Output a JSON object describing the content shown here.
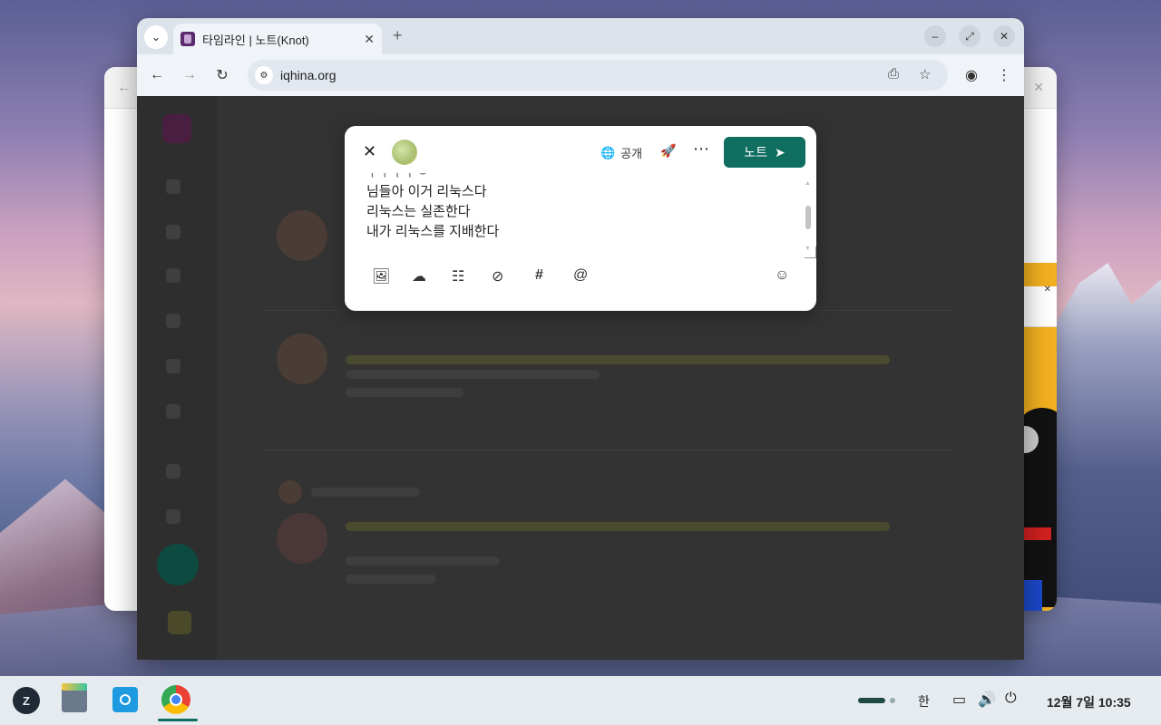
{
  "browser": {
    "tab_title": "타임라인 | 노트(Knot)",
    "url": "iqhina.org"
  },
  "compose": {
    "visibility_label": "공개",
    "submit_label": "노트",
    "clipped_line": "ㅏㅏㅏㅏㅇ",
    "lines": [
      "님들아 이거 리눅스다",
      "리눅스는 실존한다",
      "내가 리눅스를 지배한다"
    ]
  },
  "icons": {
    "visibility": "globe-icon",
    "rocket": "rocket-icon",
    "submit": "send-icon",
    "tools": [
      "image-add-icon",
      "cloud-upload-icon",
      "poll-icon",
      "eye-off-icon",
      "hashtag-icon",
      "mention-icon",
      "emoji-icon"
    ]
  },
  "taskbar": {
    "ime": "한",
    "clock": "12월 7일 10:35"
  },
  "colors": {
    "accent": "#0f6e60",
    "page_dim": "#333333"
  }
}
